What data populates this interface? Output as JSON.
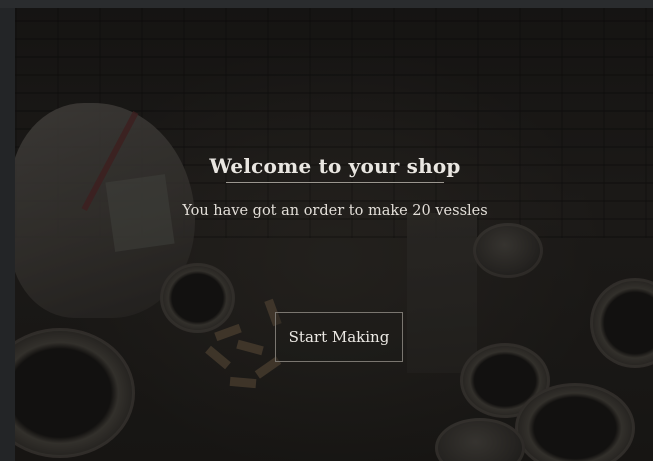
{
  "dialog": {
    "title": "Welcome to your shop",
    "message": "You have got an order to make 20 vessles",
    "start_button_label": "Start Making"
  },
  "colors": {
    "text": "#e9e6e1",
    "button_border": "#7a7670",
    "overlay": "#0a0a0a"
  }
}
